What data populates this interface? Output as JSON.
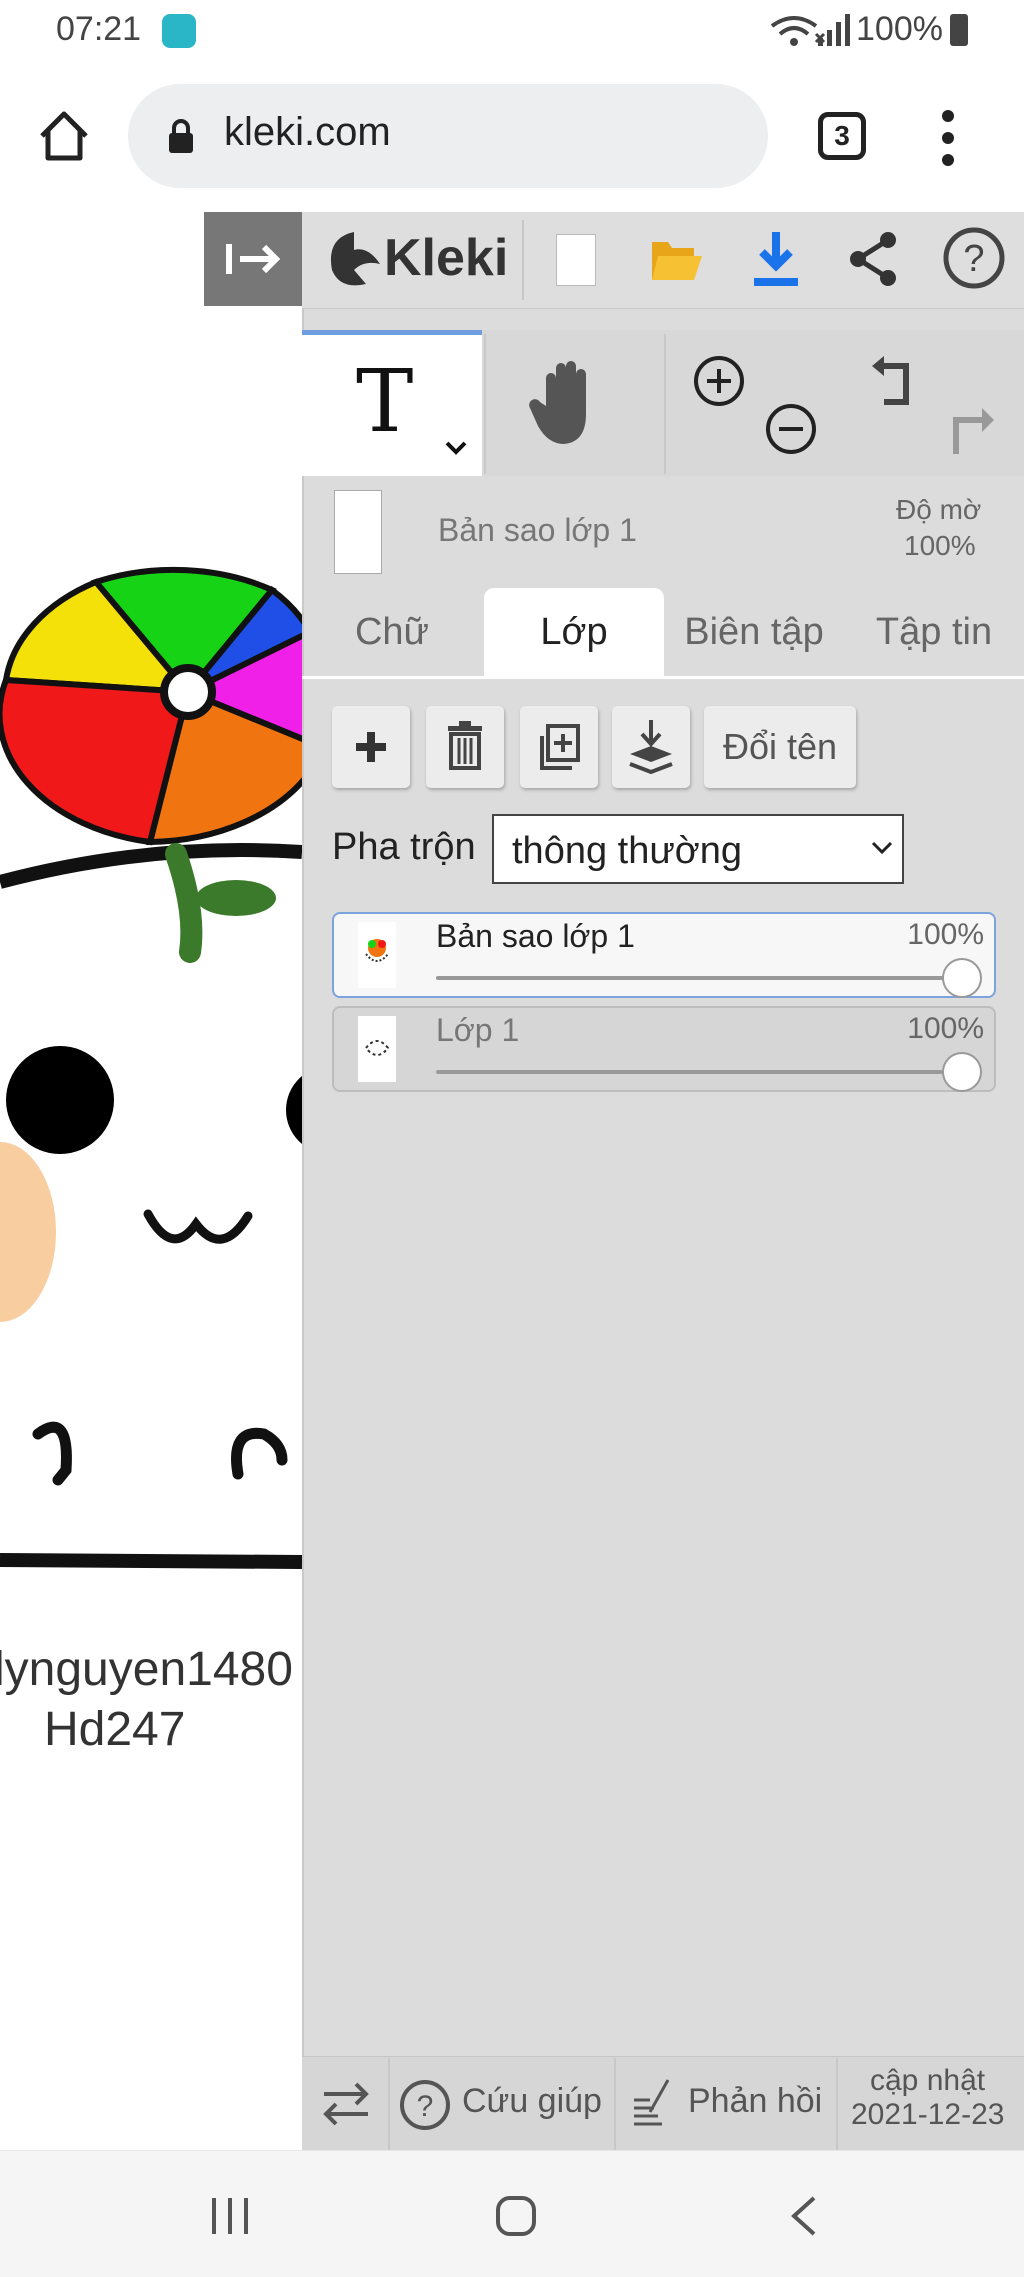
{
  "status_bar": {
    "time": "07:21",
    "battery": "100%"
  },
  "browser": {
    "url": "kleki.com",
    "tab_count": "3"
  },
  "canvas": {
    "text_line_1": "lynguyen1480",
    "text_line_2": "Hd247",
    "wheel_colors": [
      "#f5e10a",
      "#16d316",
      "#1f4fe6",
      "#f020e8",
      "#f07410",
      "#f01818"
    ]
  },
  "toolbar": {
    "logo_text": "Kleki",
    "accent_color": "#1a73e8"
  },
  "layer_info": {
    "active_layer_name": "Bản sao lớp 1",
    "opacity_label": "Độ mờ",
    "opacity_value": "100%"
  },
  "tabs": [
    {
      "label": "Chữ"
    },
    {
      "label": "Lớp"
    },
    {
      "label": "Biên tập"
    },
    {
      "label": "Tập tin"
    }
  ],
  "layer_actions": {
    "rename_label": "Đổi tên"
  },
  "blend": {
    "label": "Pha trộn",
    "value": "thông thường"
  },
  "layers": [
    {
      "name": "Bản sao lớp 1",
      "opacity": "100%",
      "selected": true
    },
    {
      "name": "Lớp 1",
      "opacity": "100%",
      "selected": false
    }
  ],
  "footer": {
    "help_label": "Cứu giúp",
    "feedback_label": "Phản hồi",
    "update_label": "cập nhật",
    "update_date": "2021-12-23"
  }
}
